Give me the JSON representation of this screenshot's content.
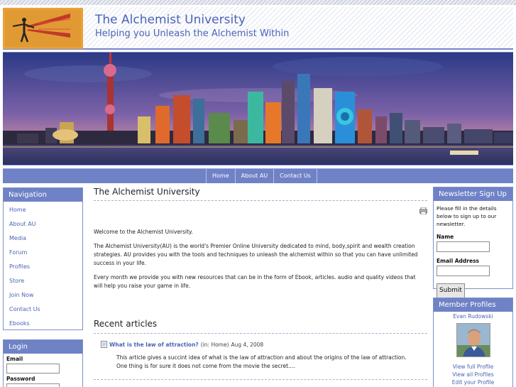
{
  "site": {
    "title": "The Alchemist University",
    "slogan": "Helping you Unleash the Alchemist Within"
  },
  "primary_nav": [
    "Home",
    "About AU",
    "Contact Us"
  ],
  "navigation_block": {
    "title": "Navigation",
    "items": [
      "Home",
      "About AU",
      "Media",
      "Forum",
      "Profiles",
      "Store",
      "Join Now",
      "Contact Us",
      "Ebooks"
    ]
  },
  "login_block": {
    "title": "Login",
    "email_label": "Email",
    "password_label": "Password"
  },
  "content": {
    "page_title": "The Alchemist University",
    "paragraphs": [
      "Welcome to the Alchemist University.",
      "The Alchemist University(AU) is the world's Premier Online University dedicated to mind, body,spirit and wealth creation strategies. AU provides you with the tools and techniques to unleash the alchemist within so that you can have unlimited success in your life.",
      "Every month we provide you with new resources that can be in the form of Ebook, articles. audio and quality videos that will help you raise your game in life."
    ],
    "recent_title": "Recent articles",
    "article": {
      "link": "What is the law of attraction?",
      "category": "(in: Home)",
      "date": "Aug 4, 2008",
      "teaser_line1": "This article gives a succint idea of what is the law of attraction and about the origins of the law of attraction.",
      "teaser_line2": "One thing is for sure it does not come from the movie the secret...."
    }
  },
  "newsletter_block": {
    "title": "Newsletter Sign Up",
    "intro": "Please fill in the details below to sign up to our newsletter.",
    "name_label": "Name",
    "email_label": "Email Address",
    "submit_label": "Submit"
  },
  "profiles_block": {
    "title": "Member Profiles",
    "member_name": "Evan Rudowski",
    "links": [
      "View full Profile",
      "View all Profiles",
      "Edit your Profile"
    ]
  },
  "colors": {
    "accent": "#6f82c6",
    "link": "#4a63b5",
    "logo_bg": "#e9a238"
  }
}
